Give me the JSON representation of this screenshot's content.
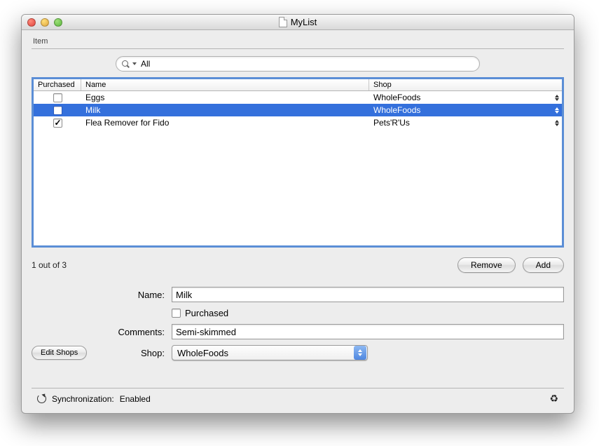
{
  "window": {
    "title": "MyList"
  },
  "group": {
    "label": "Item"
  },
  "search": {
    "value": "All"
  },
  "table": {
    "headers": {
      "purchased": "Purchased",
      "name": "Name",
      "shop": "Shop"
    },
    "rows": [
      {
        "purchased": false,
        "name": "Eggs",
        "shop": "WholeFoods",
        "selected": false
      },
      {
        "purchased": false,
        "name": "Milk",
        "shop": "WholeFoods",
        "selected": true
      },
      {
        "purchased": true,
        "name": "Flea Remover for Fido",
        "shop": "Pets'R'Us",
        "selected": false
      }
    ]
  },
  "count_text": "1 out of 3",
  "buttons": {
    "remove": "Remove",
    "add": "Add",
    "edit_shops": "Edit Shops"
  },
  "form": {
    "name_label": "Name:",
    "name_value": "Milk",
    "purchased_label": "Purchased",
    "purchased_checked": false,
    "comments_label": "Comments:",
    "comments_value": "Semi-skimmed",
    "shop_label": "Shop:",
    "shop_value": "WholeFoods"
  },
  "status": {
    "sync_label": "Synchronization:",
    "sync_value": "Enabled"
  }
}
